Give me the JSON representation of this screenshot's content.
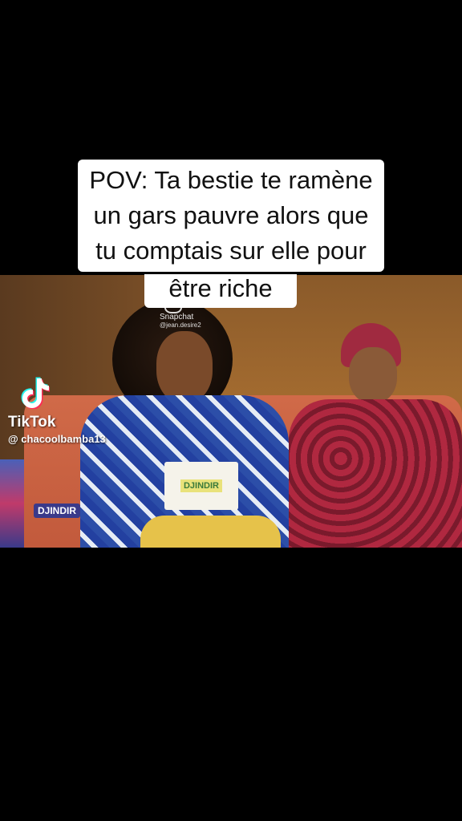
{
  "caption": {
    "lines": [
      "POV: Ta bestie te ramène",
      "un gars pauvre alors que",
      "tu comptais sur elle pour",
      "être riche"
    ]
  },
  "watermark": {
    "app_name": "TikTok",
    "username": "@ chacoolbamba13"
  },
  "snapchat": {
    "label": "Snapchat",
    "handle": "@jean.desire2"
  },
  "show_logo": "DJINDIR"
}
